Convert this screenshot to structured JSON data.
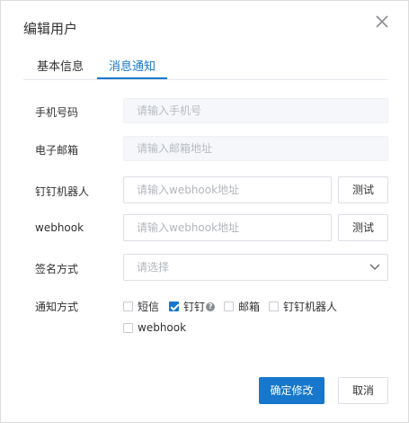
{
  "dialog": {
    "title": "编辑用户"
  },
  "tabs": [
    {
      "label": "基本信息",
      "active": false
    },
    {
      "label": "消息通知",
      "active": true
    }
  ],
  "form": {
    "phone": {
      "label": "手机号码",
      "placeholder": "请输入手机号",
      "disabled": true
    },
    "email": {
      "label": "电子邮箱",
      "placeholder": "请输入邮箱地址",
      "disabled": true
    },
    "dingtalk_robot": {
      "label": "钉钉机器人",
      "placeholder": "请输入webhook地址",
      "test_label": "测试"
    },
    "webhook": {
      "label": "webhook",
      "placeholder": "请输入webhook地址",
      "test_label": "测试"
    },
    "sign_method": {
      "label": "签名方式",
      "placeholder": "请选择"
    },
    "notify_method": {
      "label": "通知方式",
      "options": [
        {
          "label": "短信",
          "checked": false
        },
        {
          "label": "钉钉",
          "checked": true,
          "help": true
        },
        {
          "label": "邮箱",
          "checked": false
        },
        {
          "label": "钉钉机器人",
          "checked": false
        },
        {
          "label": "webhook",
          "checked": false
        }
      ]
    }
  },
  "footer": {
    "confirm_label": "确定修改",
    "cancel_label": "取消"
  },
  "colors": {
    "primary": "#1677cc",
    "border": "#dcdfe6",
    "disabled_bg": "#f5f7fa"
  },
  "icons": {
    "close": "close-icon",
    "select_arrow": "chevron-down-icon",
    "help": "question-circle-icon"
  }
}
